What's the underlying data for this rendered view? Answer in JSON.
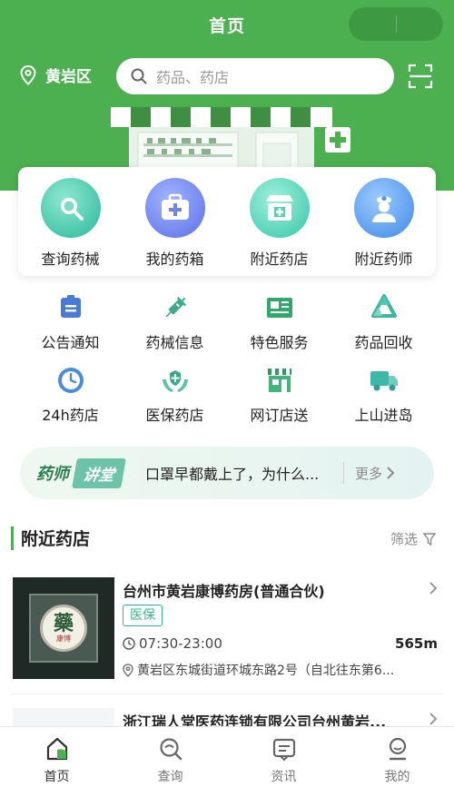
{
  "header": {
    "title": "首页",
    "location": "黄岩区",
    "search_placeholder": "药品、药店",
    "accent_color": "#4caf50"
  },
  "main_entries": [
    {
      "label": "查询药械",
      "icon": "search-icon"
    },
    {
      "label": "我的药箱",
      "icon": "medicine-box-icon"
    },
    {
      "label": "附近药店",
      "icon": "pharmacy-store-icon"
    },
    {
      "label": "附近药师",
      "icon": "pharmacist-icon"
    }
  ],
  "services": [
    {
      "label": "公告通知",
      "icon": "notice-icon"
    },
    {
      "label": "药械信息",
      "icon": "syringe-icon"
    },
    {
      "label": "特色服务",
      "icon": "news-icon"
    },
    {
      "label": "药品回收",
      "icon": "recycle-icon"
    },
    {
      "label": "24h药店",
      "icon": "clock-icon"
    },
    {
      "label": "医保药店",
      "icon": "insurance-icon"
    },
    {
      "label": "网订店送",
      "icon": "shop-icon"
    },
    {
      "label": "上山进岛",
      "icon": "delivery-truck-icon"
    }
  ],
  "banner": {
    "brand_part1": "药师",
    "brand_part2": "讲堂",
    "headline": "口罩早都戴上了，为什么...",
    "more_label": "更多"
  },
  "nearby": {
    "title": "附近药店",
    "filter_label": "筛选",
    "stores": [
      {
        "name": "台州市黄岩康博药房(普通合伙)",
        "badge": "医保",
        "hours": "07:30-23:00",
        "distance": "565m",
        "address": "黄岩区东城街道环城东路2号（自北往东第6...",
        "thumb_text": "藥",
        "thumb_subtext": "康博"
      },
      {
        "name": "浙江瑞人堂医药连锁有限公司台州黄岩..."
      }
    ]
  },
  "tabbar": [
    {
      "label": "首页",
      "icon": "home-icon",
      "active": true
    },
    {
      "label": "查询",
      "icon": "search-icon",
      "active": false
    },
    {
      "label": "资讯",
      "icon": "news-message-icon",
      "active": false
    },
    {
      "label": "我的",
      "icon": "profile-icon",
      "active": false
    }
  ]
}
